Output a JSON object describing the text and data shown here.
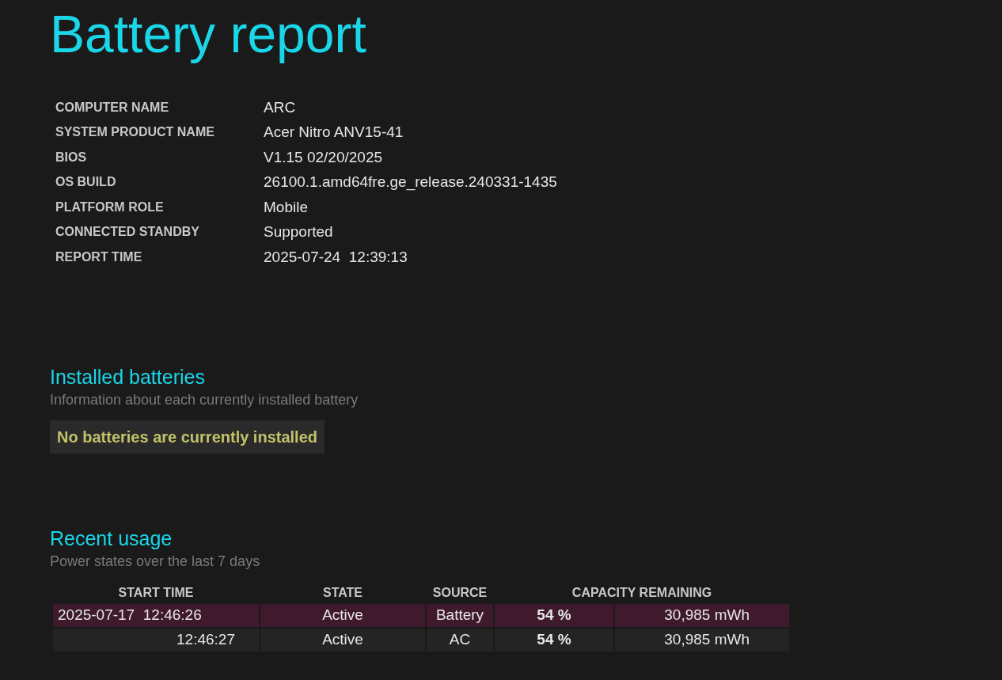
{
  "title": "Battery report",
  "system_info": [
    {
      "label": "COMPUTER NAME",
      "value": "ARC"
    },
    {
      "label": "SYSTEM PRODUCT NAME",
      "value": "Acer Nitro ANV15-41"
    },
    {
      "label": "BIOS",
      "value": "V1.15 02/20/2025"
    },
    {
      "label": "OS BUILD",
      "value": "26100.1.amd64fre.ge_release.240331-1435"
    },
    {
      "label": "PLATFORM ROLE",
      "value": "Mobile"
    },
    {
      "label": "CONNECTED STANDBY",
      "value": "Supported"
    },
    {
      "label": "REPORT TIME",
      "value": "2025-07-24  12:39:13"
    }
  ],
  "installed_batteries": {
    "heading": "Installed batteries",
    "subtitle": "Information about each currently installed battery",
    "notice": "No batteries are currently installed"
  },
  "recent_usage": {
    "heading": "Recent usage",
    "subtitle": "Power states over the last 7 days",
    "columns": [
      "START TIME",
      "STATE",
      "SOURCE",
      "CAPACITY REMAINING"
    ],
    "rows": [
      {
        "kind": "battery",
        "start_time": "2025-07-17  12:46:26",
        "state": "Active",
        "source": "Battery",
        "percent": "54 %",
        "energy": "30,985 mWh"
      },
      {
        "kind": "ac",
        "start_time": "12:46:27",
        "state": "Active",
        "source": "AC",
        "percent": "54 %",
        "energy": "30,985 mWh"
      }
    ]
  }
}
